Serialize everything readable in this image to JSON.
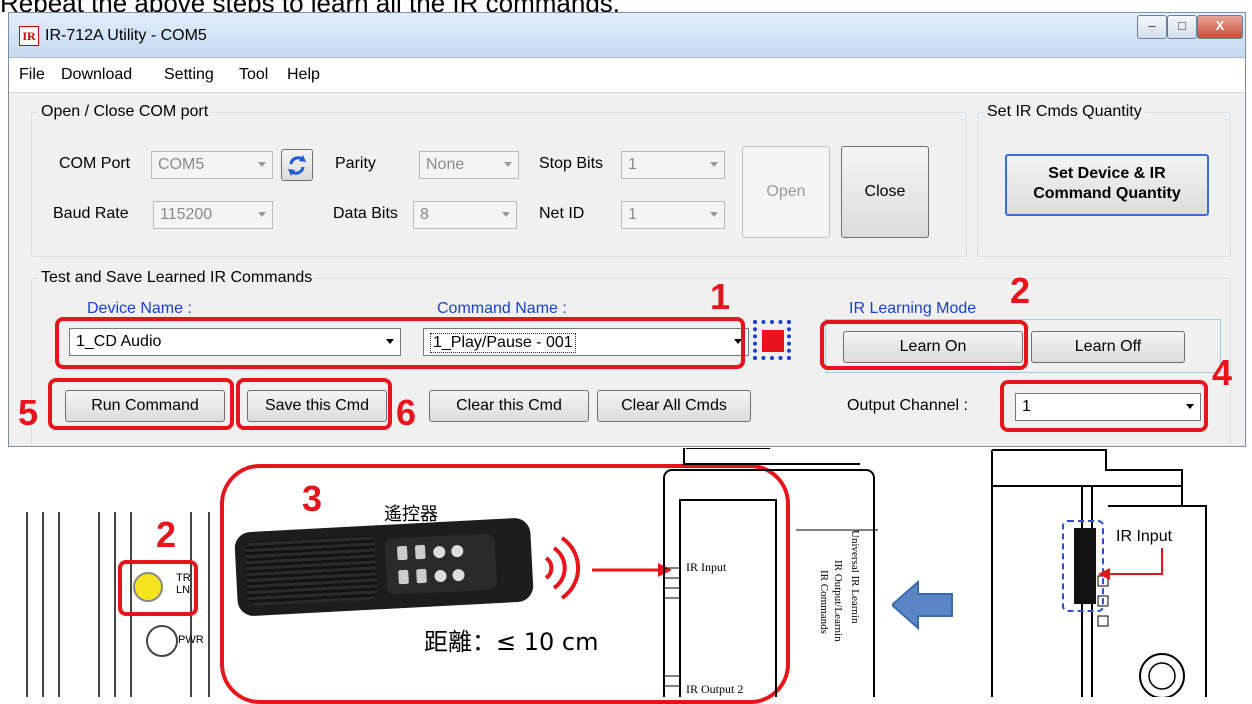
{
  "caption": "Repeat the above steps to learn all the IR commands.",
  "window": {
    "title": "IR-712A Utility - COM5",
    "icon_glyph": "IR",
    "controls": [
      "minimize-icon",
      "maximize-icon",
      "close-icon"
    ]
  },
  "menu": [
    "File",
    "Download",
    "Setting",
    "Tool",
    "Help"
  ],
  "com_group": {
    "legend": "Open / Close COM port",
    "com_port_label": "COM Port",
    "com_port_value": "COM5",
    "parity_label": "Parity",
    "parity_value": "None",
    "stop_bits_label": "Stop Bits",
    "stop_bits_value": "1",
    "baud_rate_label": "Baud Rate",
    "baud_rate_value": "115200",
    "data_bits_label": "Data Bits",
    "data_bits_value": "8",
    "net_id_label": "Net ID",
    "net_id_value": "1",
    "open_label": "Open",
    "close_label": "Close"
  },
  "qty_group": {
    "legend": "Set IR Cmds Quantity",
    "button_line1": "Set Device & IR",
    "button_line2": "Command Quantity"
  },
  "learn_group": {
    "legend": "Test and Save Learned IR Commands",
    "device_name_label": "Device Name :",
    "device_name_value": "1_CD Audio",
    "command_name_label": "Command Name :",
    "command_name_value": "1_Play/Pause - 001",
    "ir_mode_label": "IR Learning Mode",
    "learn_on": "Learn On",
    "learn_off": "Learn Off",
    "run_command": "Run Command",
    "save_cmd": "Save this Cmd",
    "clear_cmd": "Clear this Cmd",
    "clear_all": "Clear All Cmds",
    "output_channel_label": "Output Channel :",
    "output_channel_value": "1",
    "status_color": "#e8141c"
  },
  "steps": [
    "1",
    "2",
    "3",
    "4",
    "5",
    "6",
    "2"
  ],
  "diagram": {
    "remote_label": "遙控器",
    "distance_label": "距離：≤ 10 cm",
    "led_tr": "TR",
    "led_ln": "LN",
    "led_pwr": "PWR",
    "port_ir_input": "IR Input",
    "port_ir_output2": "IR Output 2",
    "side_text1": "Universal IR Learnin",
    "side_text2": "IR Output/Learnin",
    "side_text3": "IR Commands",
    "right_ir_input": "IR Input"
  },
  "colors": {
    "accent_red": "#e8141c",
    "link_blue": "#1a3fd0",
    "arrow_blue": "#5a86c4"
  }
}
